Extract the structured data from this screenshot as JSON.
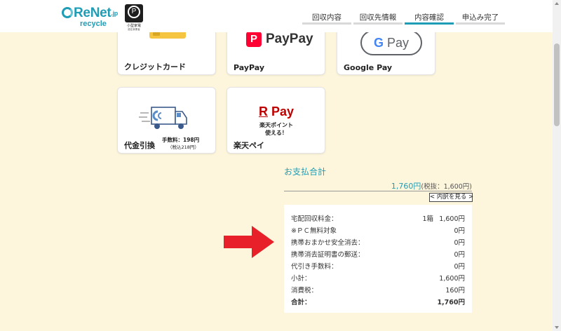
{
  "brand": {
    "name": "ReNet",
    "suffix": ".jp",
    "sub": "recycle",
    "badge_line1": "小型家電",
    "badge_line2": "認定事業者"
  },
  "steps": [
    {
      "label": "回収内容",
      "active": false
    },
    {
      "label": "回収先情報",
      "active": false
    },
    {
      "label": "内容確認",
      "active": true
    },
    {
      "label": "申込み完了",
      "active": false
    }
  ],
  "payment_methods": {
    "credit": {
      "label": "クレジットカード"
    },
    "paypay": {
      "label": "PayPay",
      "logo_mark": "P",
      "logo_text": "PayPay"
    },
    "googlepay": {
      "label": "Google Pay",
      "logo_g": "G",
      "logo_text": "Pay"
    },
    "cod": {
      "label": "代金引換",
      "fee": "手数料：198円",
      "fee_tax": "（税込218円）"
    },
    "rakuten": {
      "label": "楽天ペイ",
      "logo_r": "R",
      "logo_text": " Pay",
      "promo_line1": "楽天ポイント",
      "promo_line2": "使える！"
    }
  },
  "summary": {
    "title": "お支払合計",
    "total": "1,760円",
    "total_ex": "(税抜：1,600円)",
    "detail_button": "< 内訳を見る >",
    "rows": [
      {
        "label": "宅配回収料金：",
        "qty": "1箱",
        "value": "1,600円"
      },
      {
        "label": "※ＰＣ無料対象",
        "qty": "",
        "value": "0円"
      },
      {
        "label": "携帯おまかせ安全消去：",
        "qty": "",
        "value": "0円"
      },
      {
        "label": "携帯消去証明書の郵送：",
        "qty": "",
        "value": "0円"
      },
      {
        "label": "代引き手数料：",
        "qty": "",
        "value": "0円"
      },
      {
        "label": "小計：",
        "qty": "",
        "value": "1,600円"
      },
      {
        "label": "消費税：",
        "qty": "",
        "value": "160円"
      },
      {
        "label": "合計：",
        "qty": "",
        "value": "1,760円"
      }
    ]
  },
  "colors": {
    "accent": "#1f9db7",
    "background": "#fdf6dc",
    "arrow": "#e8202a"
  }
}
